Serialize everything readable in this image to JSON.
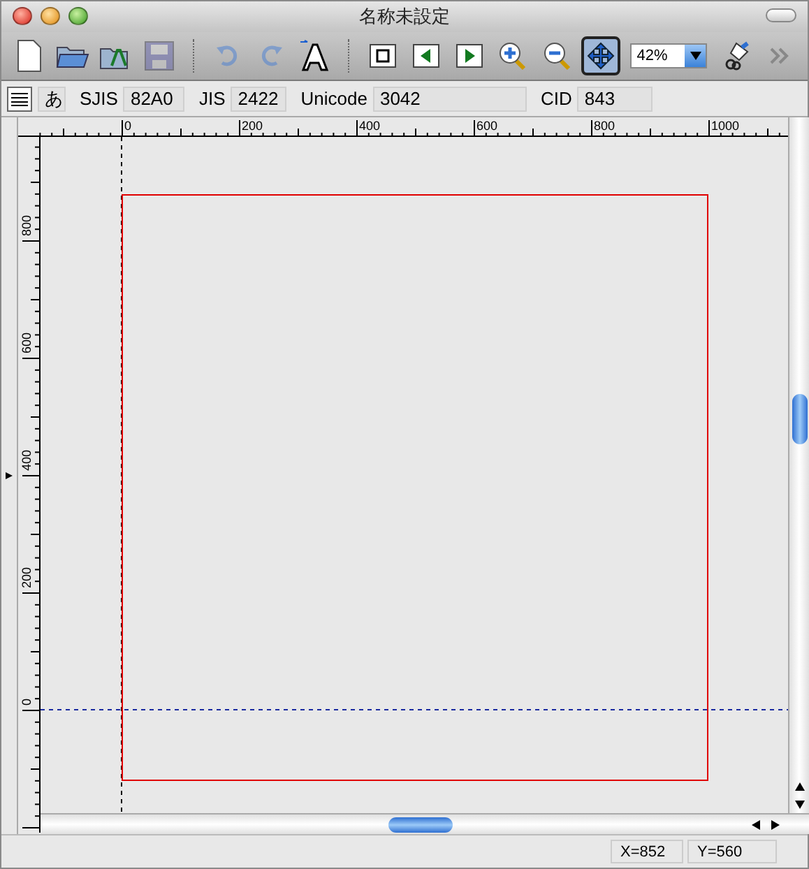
{
  "window": {
    "title": "名称未設定"
  },
  "toolbar": [
    {
      "kind": "new-document",
      "disabled": false,
      "selected": false
    },
    {
      "kind": "open-folder",
      "disabled": false,
      "selected": false
    },
    {
      "kind": "import",
      "disabled": false,
      "selected": false
    },
    {
      "kind": "save",
      "disabled": true,
      "selected": false
    },
    {
      "kind": "separator"
    },
    {
      "kind": "undo",
      "disabled": true,
      "selected": false
    },
    {
      "kind": "redo",
      "disabled": true,
      "selected": false
    },
    {
      "kind": "font",
      "disabled": false,
      "selected": false
    },
    {
      "kind": "separator"
    },
    {
      "kind": "glyph-box",
      "disabled": false,
      "selected": false
    },
    {
      "kind": "previous",
      "disabled": false,
      "selected": false
    },
    {
      "kind": "next",
      "disabled": false,
      "selected": false
    },
    {
      "kind": "zoom-in",
      "disabled": false,
      "selected": false
    },
    {
      "kind": "zoom-out",
      "disabled": false,
      "selected": false
    },
    {
      "kind": "fit",
      "disabled": false,
      "selected": true
    },
    {
      "kind": "zoom-select",
      "value": "42%"
    },
    {
      "kind": "paint",
      "disabled": false,
      "selected": false
    },
    {
      "kind": "overflow"
    }
  ],
  "info_bar": {
    "glyph": "あ",
    "fields": [
      {
        "label": "SJIS",
        "value": "82A0"
      },
      {
        "label": "JIS",
        "value": "2422"
      },
      {
        "label": "Unicode",
        "value": "3042"
      },
      {
        "label": "CID",
        "value": "843"
      }
    ]
  },
  "rulers": {
    "horizontal_labels": [
      "0",
      "200",
      "400",
      "600",
      "800",
      "1000"
    ],
    "vertical_labels": [
      "800",
      "600",
      "400",
      "200",
      "0"
    ]
  },
  "status_bar": {
    "x": "X=852",
    "y": "Y=560"
  }
}
